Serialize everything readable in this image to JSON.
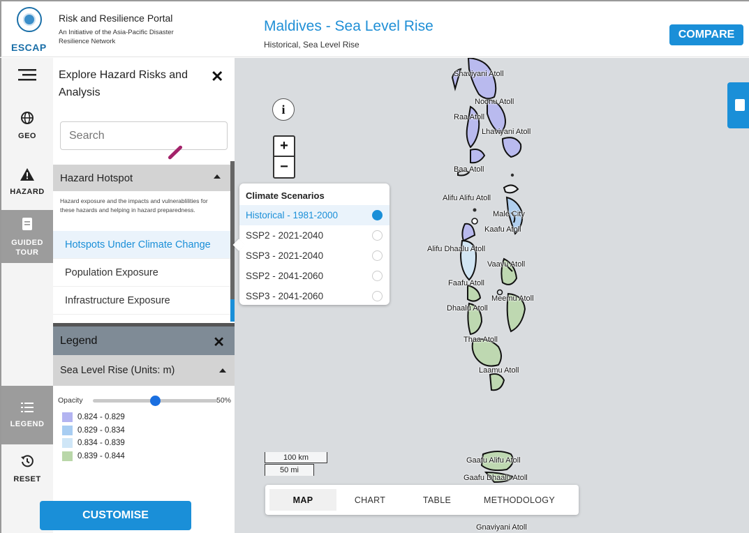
{
  "header": {
    "logo_text": "ESCAP",
    "portal_title": "Risk and Resilience Portal",
    "portal_subtitle": "An Initiative of the Asia-Pacific Disaster Resilience Network",
    "page_title": "Maldives - Sea Level Rise",
    "page_subtitle": "Historical, Sea Level Rise",
    "compare_label": "COMPARE"
  },
  "rail": {
    "geo_label": "GEO",
    "hazard_label": "HAZARD",
    "guided_tour_label": "GUIDED TOUR",
    "legend_label": "LEGEND",
    "reset_label": "RESET"
  },
  "panel": {
    "title": "Explore Hazard Risks and Analysis",
    "search_placeholder": "Search",
    "hazard_section": {
      "title": "Hazard Hotspot",
      "description": "Hazard exposure and the impacts and vulnerablilities for these hazards and helping in hazard preparedness.",
      "items": [
        {
          "label": "Hotspots Under Climate Change",
          "active": true
        },
        {
          "label": "Population Exposure",
          "active": false
        },
        {
          "label": "Infrastructure Exposure",
          "active": false
        }
      ]
    },
    "legend": {
      "title": "Legend",
      "layer_title": "Sea Level Rise (Units: m)",
      "opacity_label": "Opacity",
      "opacity_value": "50%",
      "opacity_fraction": 0.5,
      "classes": [
        {
          "label": "0.824 - 0.829",
          "color": "#b3b4f1"
        },
        {
          "label": "0.829 - 0.834",
          "color": "#a8cdf2"
        },
        {
          "label": "0.834 - 0.839",
          "color": "#cfe6f7"
        },
        {
          "label": "0.839 - 0.844",
          "color": "#b9d7a9"
        }
      ]
    },
    "customise_label": "CUSTOMISE"
  },
  "map": {
    "info_glyph": "i",
    "zoom_in": "+",
    "zoom_out": "−",
    "scale_km": "100 km",
    "scale_mi": "50 mi",
    "atolls": [
      "Shaviyani Atoll",
      "Noonu Atoll",
      "Raa Atoll",
      "Lhaviyani Atoll",
      "Baa Atoll",
      "Alifu Alifu Atoll",
      "Malé City",
      "Kaafu Atoll",
      "Alifu Dhaalu Atoll",
      "Vaavu Atoll",
      "Faafu Atoll",
      "Meemu Atoll",
      "Dhaalu Atoll",
      "Thaa Atoll",
      "Laamu Atoll",
      "Gaafu Alifu Atoll",
      "Gaafu Dhaalu Atoll",
      "Gnaviyani Atoll"
    ],
    "scenarios": {
      "title": "Climate Scenarios",
      "options": [
        {
          "label": "Historical - 1981-2000",
          "selected": true
        },
        {
          "label": "SSP2 - 2021-2040",
          "selected": false
        },
        {
          "label": "SSP3 - 2021-2040",
          "selected": false
        },
        {
          "label": "SSP2 - 2041-2060",
          "selected": false
        },
        {
          "label": "SSP3 - 2041-2060",
          "selected": false
        }
      ]
    },
    "tabs": [
      {
        "label": "MAP",
        "active": true
      },
      {
        "label": "CHART",
        "active": false
      },
      {
        "label": "TABLE",
        "active": false
      },
      {
        "label": "METHODOLOGY",
        "active": false
      }
    ]
  }
}
